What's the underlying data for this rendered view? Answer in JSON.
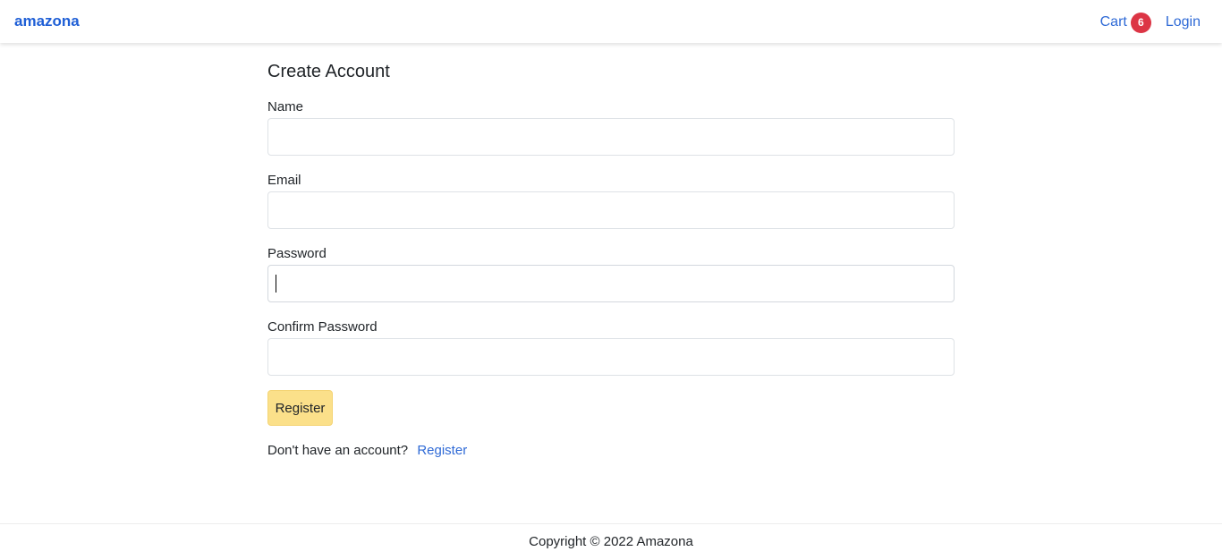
{
  "header": {
    "brand": "amazona",
    "cart_label": "Cart",
    "cart_count": "6",
    "login_label": "Login"
  },
  "form": {
    "title": "Create Account",
    "fields": [
      {
        "label": "Name",
        "value": "",
        "placeholder": ""
      },
      {
        "label": "Email",
        "value": "",
        "placeholder": ""
      },
      {
        "label": "Password",
        "value": "",
        "placeholder": ""
      },
      {
        "label": "Confirm Password",
        "value": "",
        "placeholder": ""
      }
    ],
    "submit_label": "Register",
    "account_prompt": "Don't have an account?",
    "account_link": "Register"
  },
  "footer": {
    "copyright": "Copyright © 2022 Amazona"
  },
  "colors": {
    "brand": "#1f5fd6",
    "link": "#2f6ad6",
    "badge": "#dc3545",
    "button": "#fbe08a"
  }
}
